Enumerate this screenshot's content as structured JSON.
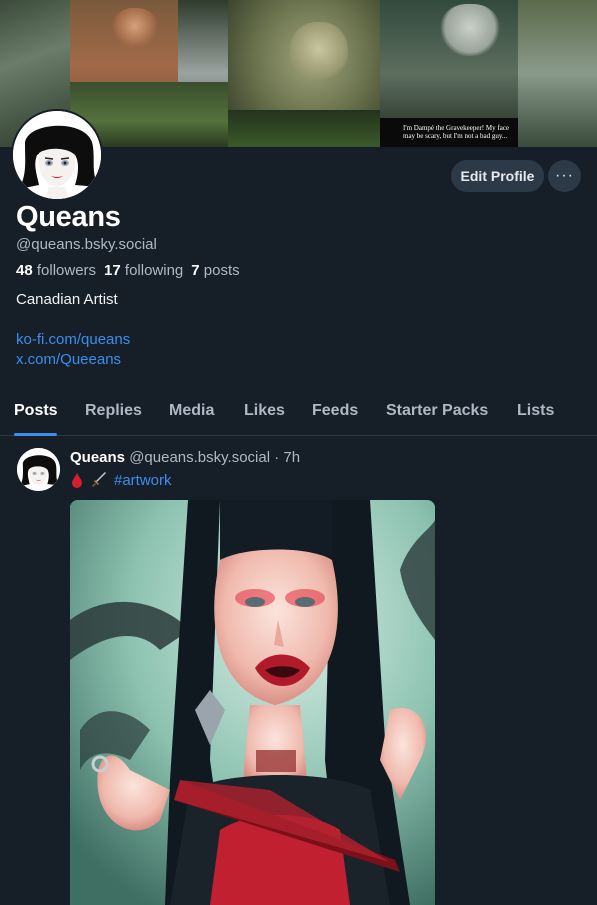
{
  "banner": {
    "caption": "I'm Dampé the Gravekeeper! My face may be scary, but I'm not a bad guy..."
  },
  "profile": {
    "display_name": "Queans",
    "handle": "@queans.bsky.social",
    "followers_count": "48",
    "followers_label": "followers",
    "following_count": "17",
    "following_label": "following",
    "posts_count": "7",
    "posts_label": "posts",
    "bio": "Canadian Artist",
    "links": [
      "ko-fi.com/queans",
      "x.com/Queeans"
    ]
  },
  "actions": {
    "edit_label": "Edit Profile",
    "more_label": "···"
  },
  "tabs": [
    {
      "label": "Posts",
      "active": true
    },
    {
      "label": "Replies",
      "active": false
    },
    {
      "label": "Media",
      "active": false
    },
    {
      "label": "Likes",
      "active": false
    },
    {
      "label": "Feeds",
      "active": false
    },
    {
      "label": "Starter Packs",
      "active": false
    },
    {
      "label": "Lists",
      "active": false
    }
  ],
  "post": {
    "author": "Queans",
    "handle": "@queans.bsky.social",
    "separator": "·",
    "time": "7h",
    "emojis": [
      "blood-drop-icon",
      "dagger-icon"
    ],
    "hashtag": "#artwork"
  },
  "colors": {
    "background": "#161e27",
    "accent": "#3b8ef0",
    "button_bg": "#2c3a48",
    "muted_text": "#aeb9c5"
  }
}
